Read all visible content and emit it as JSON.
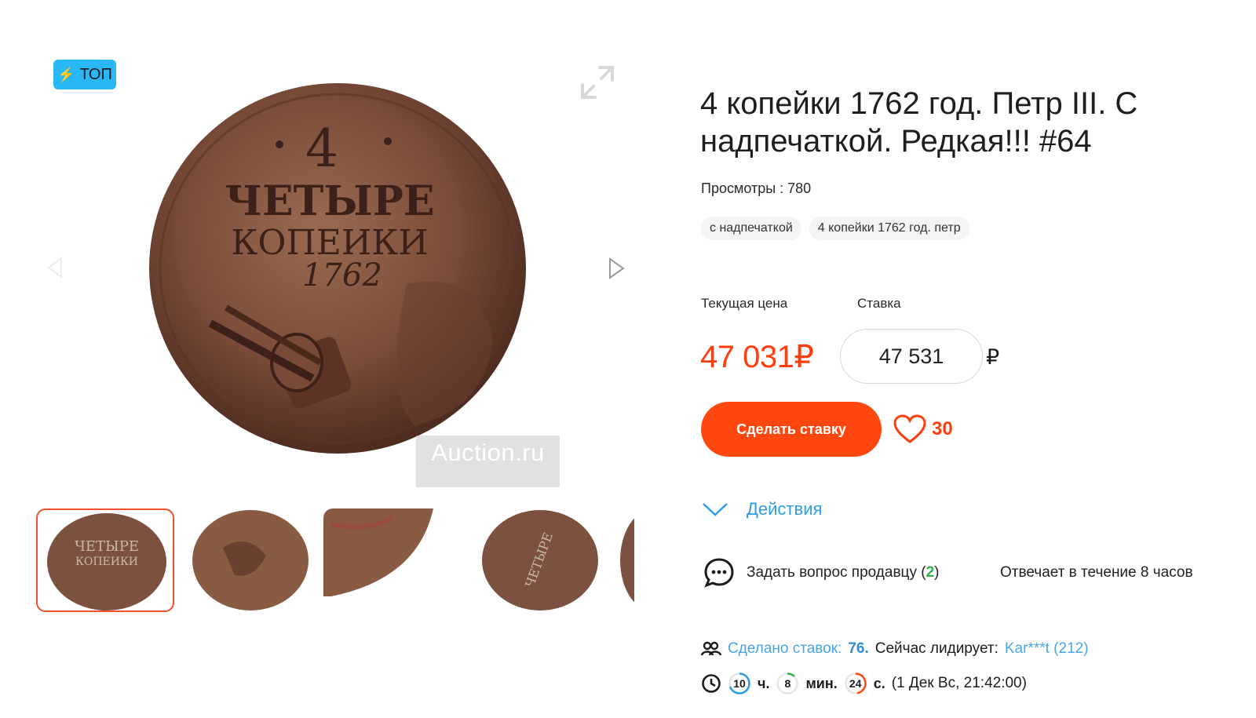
{
  "badge": {
    "label": "ТОП"
  },
  "watermark": {
    "text": "Auction.ru"
  },
  "lot": {
    "title": "4 копейки 1762 год. Петр III. С надпечаткой. Редкая!!! #64",
    "views": "Просмотры : 780",
    "tags": [
      "с надпечаткой",
      "4 копейки 1762 год. петр"
    ]
  },
  "pricing": {
    "current_label": "Текущая цена",
    "bid_label": "Ставка",
    "current_price": "47 031₽",
    "bid_value": "47 531",
    "currency": "₽"
  },
  "buttons": {
    "bid": "Сделать ставку"
  },
  "favorites": {
    "count": "30"
  },
  "actions": {
    "label": "Действия"
  },
  "question": {
    "text": "Задать вопрос продавцу (",
    "count": "2",
    "close": ")",
    "reply_time": "Отвечает в течение 8 часов"
  },
  "bids": {
    "made_label": "Сделано ставок:",
    "count": "76.",
    "leader_label": "Сейчас лидирует:",
    "leader": "Kar***t (212)"
  },
  "timer": {
    "hours": "10",
    "hours_unit": "ч.",
    "minutes": "8",
    "minutes_unit": "мин.",
    "seconds": "24",
    "seconds_unit": "с.",
    "end": "(1 Дек Вс, 21:42:00)"
  },
  "colors": {
    "accent": "#ff4810",
    "price": "#ff3d0d",
    "link": "#2f9de6",
    "badge": "#2ab7f6",
    "counter_green": "#2db24a"
  },
  "icons": [
    "bolt-icon",
    "expand-icon",
    "chevron-left-icon",
    "chevron-right-icon",
    "heart-icon",
    "chevron-down-icon",
    "chat-icon",
    "users-icon",
    "clock-icon"
  ]
}
